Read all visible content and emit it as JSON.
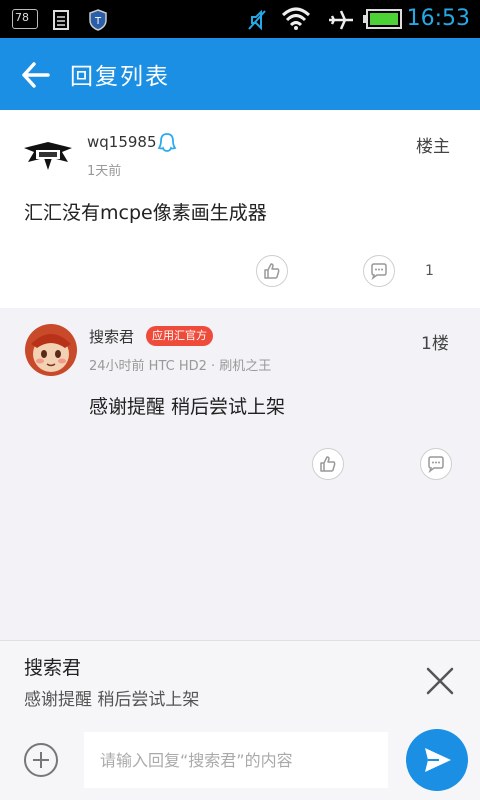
{
  "status_bar": {
    "time": "16:53",
    "badge_text": "78",
    "icons": [
      "notification-badge-icon",
      "document-icon",
      "shield-icon",
      "mute-icon",
      "wifi-icon",
      "airplane-icon",
      "battery-icon"
    ]
  },
  "header": {
    "title": "回复列表",
    "back_icon": "arrow-left-icon"
  },
  "post": {
    "username": "wq15985",
    "time": "1天前",
    "floor": "楼主",
    "content": "汇汇没有mcpe像素画生成器",
    "comment_count": "1",
    "icons": [
      "qq-icon",
      "thumbs-up-icon",
      "comment-icon"
    ]
  },
  "reply": {
    "username": "搜索君",
    "badge": "应用汇官方",
    "meta": "24小时前  HTC HD2 · 刷机之王",
    "floor": "1楼",
    "content": "感谢提醒 稍后尝试上架"
  },
  "quote": {
    "name": "搜索君",
    "text": "感谢提醒 稍后尝试上架"
  },
  "input": {
    "placeholder": "请输入回复“搜索君”的内容"
  },
  "colors": {
    "brand": "#1a8fe3",
    "badge": "#ef4b3a",
    "status_time": "#25a8e6",
    "battery": "#4cd137"
  }
}
